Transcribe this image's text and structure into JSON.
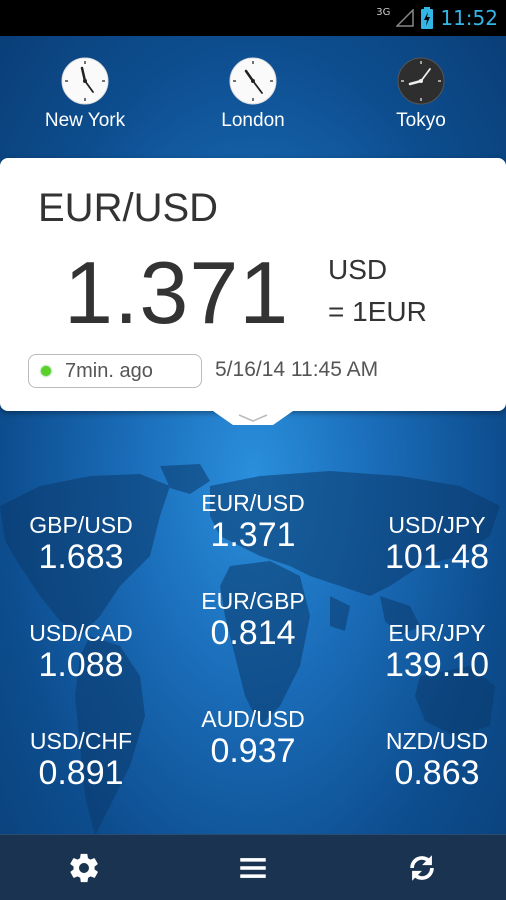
{
  "status_bar": {
    "network": "3G",
    "time": "11:52",
    "time_color": "#33b5e5"
  },
  "clocks": [
    {
      "city": "New York",
      "theme": "light"
    },
    {
      "city": "London",
      "theme": "light"
    },
    {
      "city": "Tokyo",
      "theme": "dark"
    }
  ],
  "main_card": {
    "pair": "EUR/USD",
    "rate": "1.371",
    "unit": "USD",
    "equivalence": "= 1EUR",
    "updated": "7min. ago",
    "timestamp": "5/16/14 11:45 AM",
    "live_color": "#5ad12a"
  },
  "quotes": [
    {
      "pair": "GBP/USD",
      "rate": "1.683"
    },
    {
      "pair": "EUR/USD",
      "rate": "1.371"
    },
    {
      "pair": "USD/JPY",
      "rate": "101.48"
    },
    {
      "pair": "USD/CAD",
      "rate": "1.088"
    },
    {
      "pair": "EUR/GBP",
      "rate": "0.814"
    },
    {
      "pair": "EUR/JPY",
      "rate": "139.10"
    },
    {
      "pair": "USD/CHF",
      "rate": "0.891"
    },
    {
      "pair": "AUD/USD",
      "rate": "0.937"
    },
    {
      "pair": "NZD/USD",
      "rate": "0.863"
    }
  ],
  "bottom_bar": {
    "icons": [
      "gear-icon",
      "menu-icon",
      "refresh-icon"
    ]
  }
}
